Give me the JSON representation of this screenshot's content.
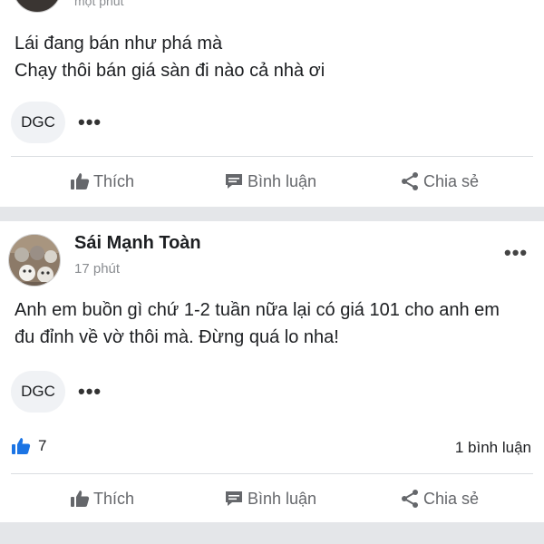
{
  "post1": {
    "time": "một phút",
    "text_lines": [
      "Lái đang bán như phá mà",
      "Chạy thôi bán giá sàn đi nào cả nhà ơi"
    ],
    "tag": "DGC",
    "more": "•••"
  },
  "post2": {
    "author": "Sái Mạnh Toàn",
    "time": "17 phút",
    "header_more": "•••",
    "text_lines": [
      "Anh em buồn gì chứ 1-2 tuần nữa lại có giá 101 cho anh em",
      "đu đỉnh về vờ thôi mà. Đừng quá lo nha!"
    ],
    "tag": "DGC",
    "more": "•••",
    "like_count": "7",
    "comment_count": "1 bình luận"
  },
  "actions": {
    "like": "Thích",
    "comment": "Bình luận",
    "share": "Chia sẻ"
  },
  "colors": {
    "like_blue": "#1b74e4",
    "icon_gray": "#65676b",
    "separator": "#e4e6e9"
  },
  "icons": {
    "like": "thumbs-up-icon",
    "comment": "comment-bubble-icon",
    "share": "share-icon",
    "reaction": "blue-like-reaction-icon"
  }
}
